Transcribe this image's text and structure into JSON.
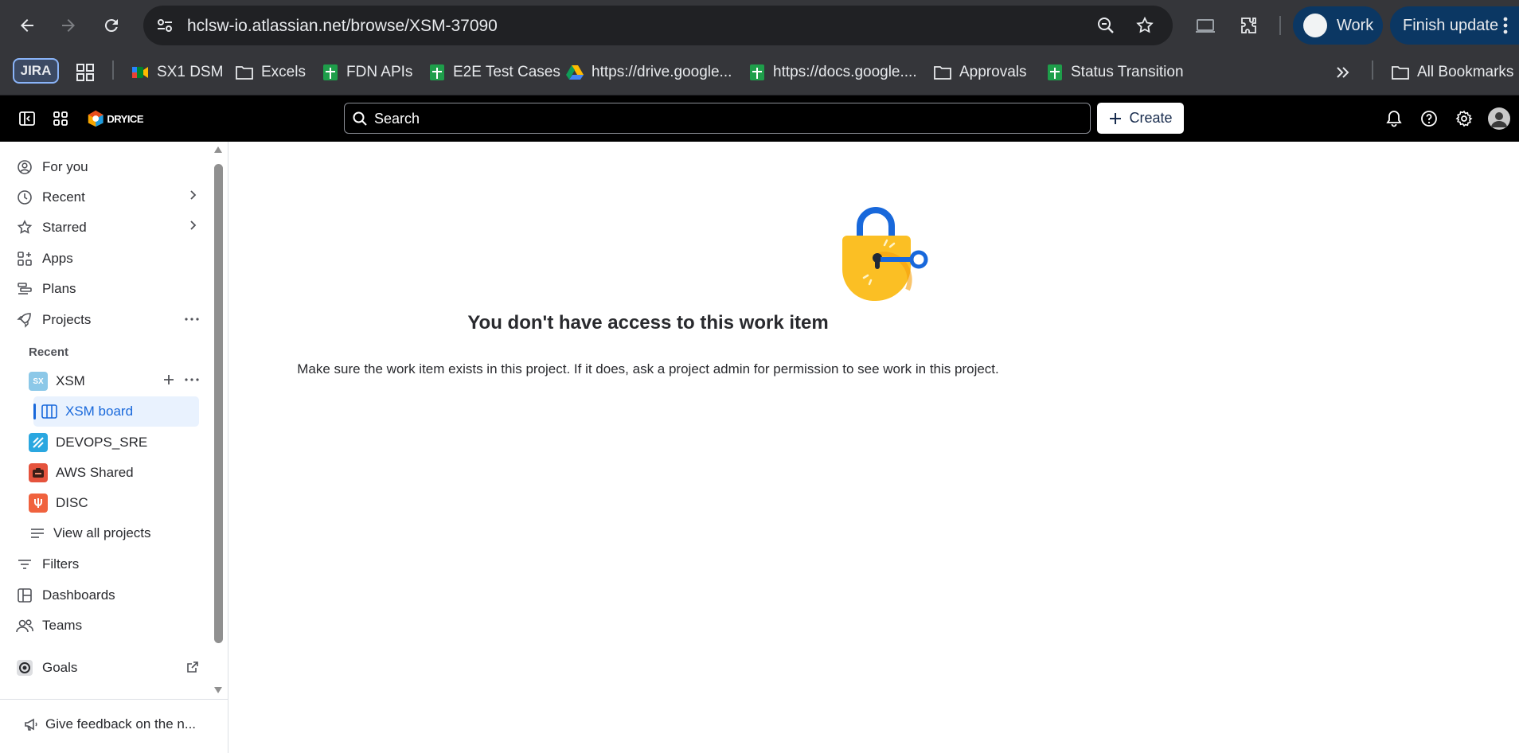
{
  "browser": {
    "url": "hclsw-io.atlassian.net/browse/XSM-37090",
    "profile_label": "Work",
    "update_label": "Finish update",
    "bookmarks": [
      {
        "label": "JIRA",
        "icon": "jira-chip"
      },
      {
        "label": "SX1 DSM",
        "icon": "meet-icon"
      },
      {
        "label": "Excels",
        "icon": "folder-icon"
      },
      {
        "label": "FDN APIs",
        "icon": "sheets-icon"
      },
      {
        "label": "E2E Test Cases",
        "icon": "sheets-icon"
      },
      {
        "label": "https://drive.google...",
        "icon": "drive-icon"
      },
      {
        "label": "https://docs.google....",
        "icon": "sheets-icon"
      },
      {
        "label": "Approvals",
        "icon": "folder-icon"
      },
      {
        "label": "Status Transition",
        "icon": "sheets-icon"
      }
    ],
    "all_bookmarks_label": "All Bookmarks"
  },
  "jira": {
    "logo_text": "DRYICE",
    "search_placeholder": "Search",
    "create_label": "Create"
  },
  "sidebar": {
    "items": [
      {
        "label": "For you"
      },
      {
        "label": "Recent"
      },
      {
        "label": "Starred"
      },
      {
        "label": "Apps"
      },
      {
        "label": "Plans"
      },
      {
        "label": "Projects"
      }
    ],
    "recent_section": "Recent",
    "projects": [
      {
        "label": "XSM",
        "badge": "SX"
      },
      {
        "label": "XSM board"
      },
      {
        "label": "DEVOPS_SRE"
      },
      {
        "label": "AWS Shared"
      },
      {
        "label": "DISC"
      },
      {
        "label": "View all projects"
      }
    ],
    "bottom_items": [
      {
        "label": "Filters"
      },
      {
        "label": "Dashboards"
      },
      {
        "label": "Teams"
      },
      {
        "label": "Goals"
      }
    ],
    "feedback": "Give feedback on the n..."
  },
  "main": {
    "title": "You don't have access to this work item",
    "description": "Make sure the work item exists in this project. If it does, ask a project admin for permission to see work in this project."
  },
  "colors": {
    "accent": "#1868db",
    "chrome_bg": "#35363a",
    "topbar_bg": "#000000",
    "lock_body": "#fbbf24",
    "lock_shackle": "#1868db"
  }
}
